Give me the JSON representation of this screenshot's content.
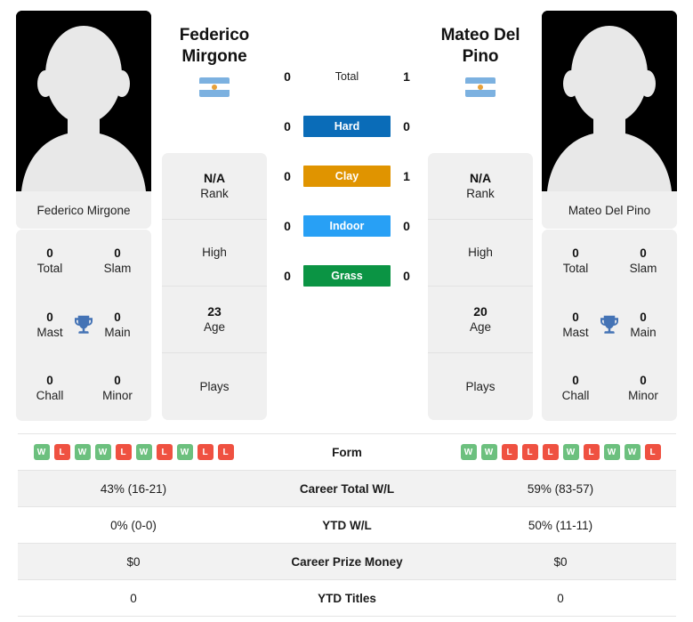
{
  "players": {
    "left": {
      "name": "Federico Mirgone",
      "name_display": "Federico\nMirgone",
      "first_line": "Federico",
      "second_line": "Mirgone",
      "flag": "argentina-flag",
      "rank": "N/A",
      "rank_label": "Rank",
      "high_label": "High",
      "high_value": "",
      "age": "23",
      "age_label": "Age",
      "plays_label": "Plays",
      "plays_value": "",
      "titles": {
        "total": "0",
        "total_label": "Total",
        "slam": "0",
        "slam_label": "Slam",
        "mast": "0",
        "mast_label": "Mast",
        "main": "0",
        "main_label": "Main",
        "chall": "0",
        "chall_label": "Chall",
        "minor": "0",
        "minor_label": "Minor"
      },
      "form": [
        "W",
        "L",
        "W",
        "W",
        "L",
        "W",
        "L",
        "W",
        "L",
        "L"
      ],
      "career_wl": "43% (16-21)",
      "ytd_wl": "0% (0-0)",
      "career_prize": "$0",
      "ytd_titles": "0"
    },
    "right": {
      "name": "Mateo Del Pino",
      "first_line": "Mateo Del",
      "second_line": "Pino",
      "flag": "argentina-flag",
      "rank": "N/A",
      "rank_label": "Rank",
      "high_label": "High",
      "high_value": "",
      "age": "20",
      "age_label": "Age",
      "plays_label": "Plays",
      "plays_value": "",
      "titles": {
        "total": "0",
        "total_label": "Total",
        "slam": "0",
        "slam_label": "Slam",
        "mast": "0",
        "mast_label": "Mast",
        "main": "0",
        "main_label": "Main",
        "chall": "0",
        "chall_label": "Chall",
        "minor": "0",
        "minor_label": "Minor"
      },
      "form": [
        "W",
        "W",
        "L",
        "L",
        "L",
        "W",
        "L",
        "W",
        "W",
        "L"
      ],
      "career_wl": "59% (83-57)",
      "ytd_wl": "50% (11-11)",
      "career_prize": "$0",
      "ytd_titles": "0"
    }
  },
  "h2h": [
    {
      "label": "Total",
      "left": "0",
      "right": "1",
      "color": "transparent",
      "plain": true
    },
    {
      "label": "Hard",
      "left": "0",
      "right": "0",
      "color": "#0a6cb8",
      "plain": false
    },
    {
      "label": "Clay",
      "left": "0",
      "right": "1",
      "color": "#e09400",
      "plain": false
    },
    {
      "label": "Indoor",
      "left": "0",
      "right": "0",
      "color": "#28a0f5",
      "plain": false
    },
    {
      "label": "Grass",
      "left": "0",
      "right": "0",
      "color": "#0b9444",
      "plain": false
    }
  ],
  "table": {
    "rows": [
      {
        "label": "Form",
        "type": "form",
        "left": "",
        "right": ""
      },
      {
        "label": "Career Total W/L",
        "type": "text",
        "left": "43% (16-21)",
        "right": "59% (83-57)"
      },
      {
        "label": "YTD W/L",
        "type": "text",
        "left": "0% (0-0)",
        "right": "50% (11-11)"
      },
      {
        "label": "Career Prize Money",
        "type": "text",
        "left": "$0",
        "right": "$0"
      },
      {
        "label": "YTD Titles",
        "type": "text",
        "left": "0",
        "right": "0"
      }
    ]
  },
  "colors": {
    "hard": "#0a6cb8",
    "clay": "#e09400",
    "indoor": "#28a0f5",
    "grass": "#0b9444",
    "win": "#6cc07e",
    "loss": "#ef5141",
    "trophy": "#4473b5",
    "card_bg": "#f0f0f0",
    "row_alt": "#f2f2f2"
  }
}
